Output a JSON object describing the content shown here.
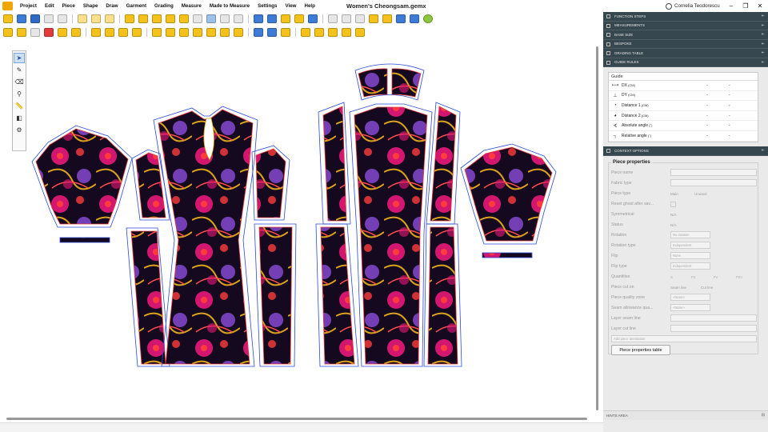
{
  "app": {
    "menus": [
      "Project",
      "Edit",
      "Piece",
      "Shape",
      "Draw",
      "Garment",
      "Grading",
      "Measure",
      "Made to Measure",
      "Settings",
      "View",
      "Help"
    ],
    "document_title": "Women's Cheongsam.gemx",
    "user_name": "Cornelia Teodorescu",
    "window_controls": {
      "minimize": "–",
      "restore": "❐",
      "close": "✕"
    }
  },
  "panel": {
    "sections": [
      {
        "label": "FUNCTION STEPS",
        "pin": "⇤"
      },
      {
        "label": "MEASUREMENTS",
        "pin": "⇤"
      },
      {
        "label": "BASE SIZE",
        "pin": "⇤"
      },
      {
        "label": "BESPOKE",
        "pin": "⇤"
      },
      {
        "label": "GRADING TABLE",
        "pin": "⇤"
      },
      {
        "label": "GUIDE RULES",
        "pin": "⇤"
      }
    ],
    "guide": {
      "title": "Guide",
      "rows": [
        {
          "icon": "⟼",
          "label": "DX",
          "unit": " (CM)",
          "v1": "-",
          "v2": "-"
        },
        {
          "icon": "⊥",
          "label": "DY",
          "unit": " (CM)",
          "v1": "-",
          "v2": "-"
        },
        {
          "icon": "◔",
          "label": "Distance 1",
          "unit": " (CM)",
          "v1": "-",
          "v2": "-"
        },
        {
          "icon": "◕",
          "label": "Distance 2",
          "unit": " (CM)",
          "v1": "-",
          "v2": "-"
        },
        {
          "icon": "∢",
          "label": "Absolute angle",
          "unit": " (°)",
          "v1": "-",
          "v2": "-"
        },
        {
          "icon": "┐",
          "label": "Relative angle",
          "unit": " (°)",
          "v1": "-",
          "v2": "-"
        }
      ]
    },
    "context_title": "CONTEXT OPTIONS",
    "context_pin": "⇤",
    "piece_properties": {
      "title": "Piece properties",
      "piece_name": "Piece name",
      "fabric_type": "Fabric type",
      "piece_type": "Piece type",
      "piece_type_options": [
        "Main",
        "Unused"
      ],
      "reset_ghost": "Reset ghost after sav...",
      "symmetrical": "Symmetrical",
      "symmetrical_value": "N/A",
      "status": "Status",
      "status_value": "N/A",
      "rotation": "Rotation",
      "rotation_value": "No rotation",
      "rotation_type": "Rotation type",
      "rotation_type_value": "Independent",
      "flip": "Flip",
      "flip_value": "None",
      "flip_type": "Flip type",
      "flip_type_value": "Independent",
      "quantities": "Quantities",
      "quantity_fields": [
        "S",
        "FS",
        "FV",
        "FSV"
      ],
      "piece_cut_on": "Piece cut on",
      "piece_cut_on_options": [
        "Seam line",
        "Cut line"
      ],
      "piece_quality_zone": "Piece quality zone",
      "piece_quality_zone_value": "<None>",
      "seam_allowance_quality": "Seam allowance qua...",
      "seam_allowance_quality_value": "<None>",
      "layer_seam_line": "Layer seam line",
      "layer_cut_line": "Layer cut line",
      "add_piece_annotation": "Add piece annotation",
      "properties_table_button": "Piece properties table"
    },
    "hints_title": "HINTS AREA",
    "hints_pin": "⊟"
  },
  "tools": [
    {
      "name": "select-arrow-icon",
      "glyph": "➤"
    },
    {
      "name": "edit-point-icon",
      "glyph": "✎"
    },
    {
      "name": "eraser-icon",
      "glyph": "⌫"
    },
    {
      "name": "pipette-icon",
      "glyph": "⚲"
    },
    {
      "name": "ruler-icon",
      "glyph": "📏"
    },
    {
      "name": "fill-icon",
      "glyph": "◧"
    },
    {
      "name": "stamp-icon",
      "glyph": "⚙"
    }
  ],
  "colors": {
    "fabric_bg": "#15091f",
    "fabric_pink": "#e8187a",
    "fabric_red": "#ff3b3b",
    "fabric_gold": "#d9a21e",
    "fabric_purple": "#8c4cd9",
    "outline_red": "#e23b3b",
    "outline_blue": "#2b4ad6",
    "outline_gold": "#c8a400",
    "panel_header": "#37474f"
  }
}
